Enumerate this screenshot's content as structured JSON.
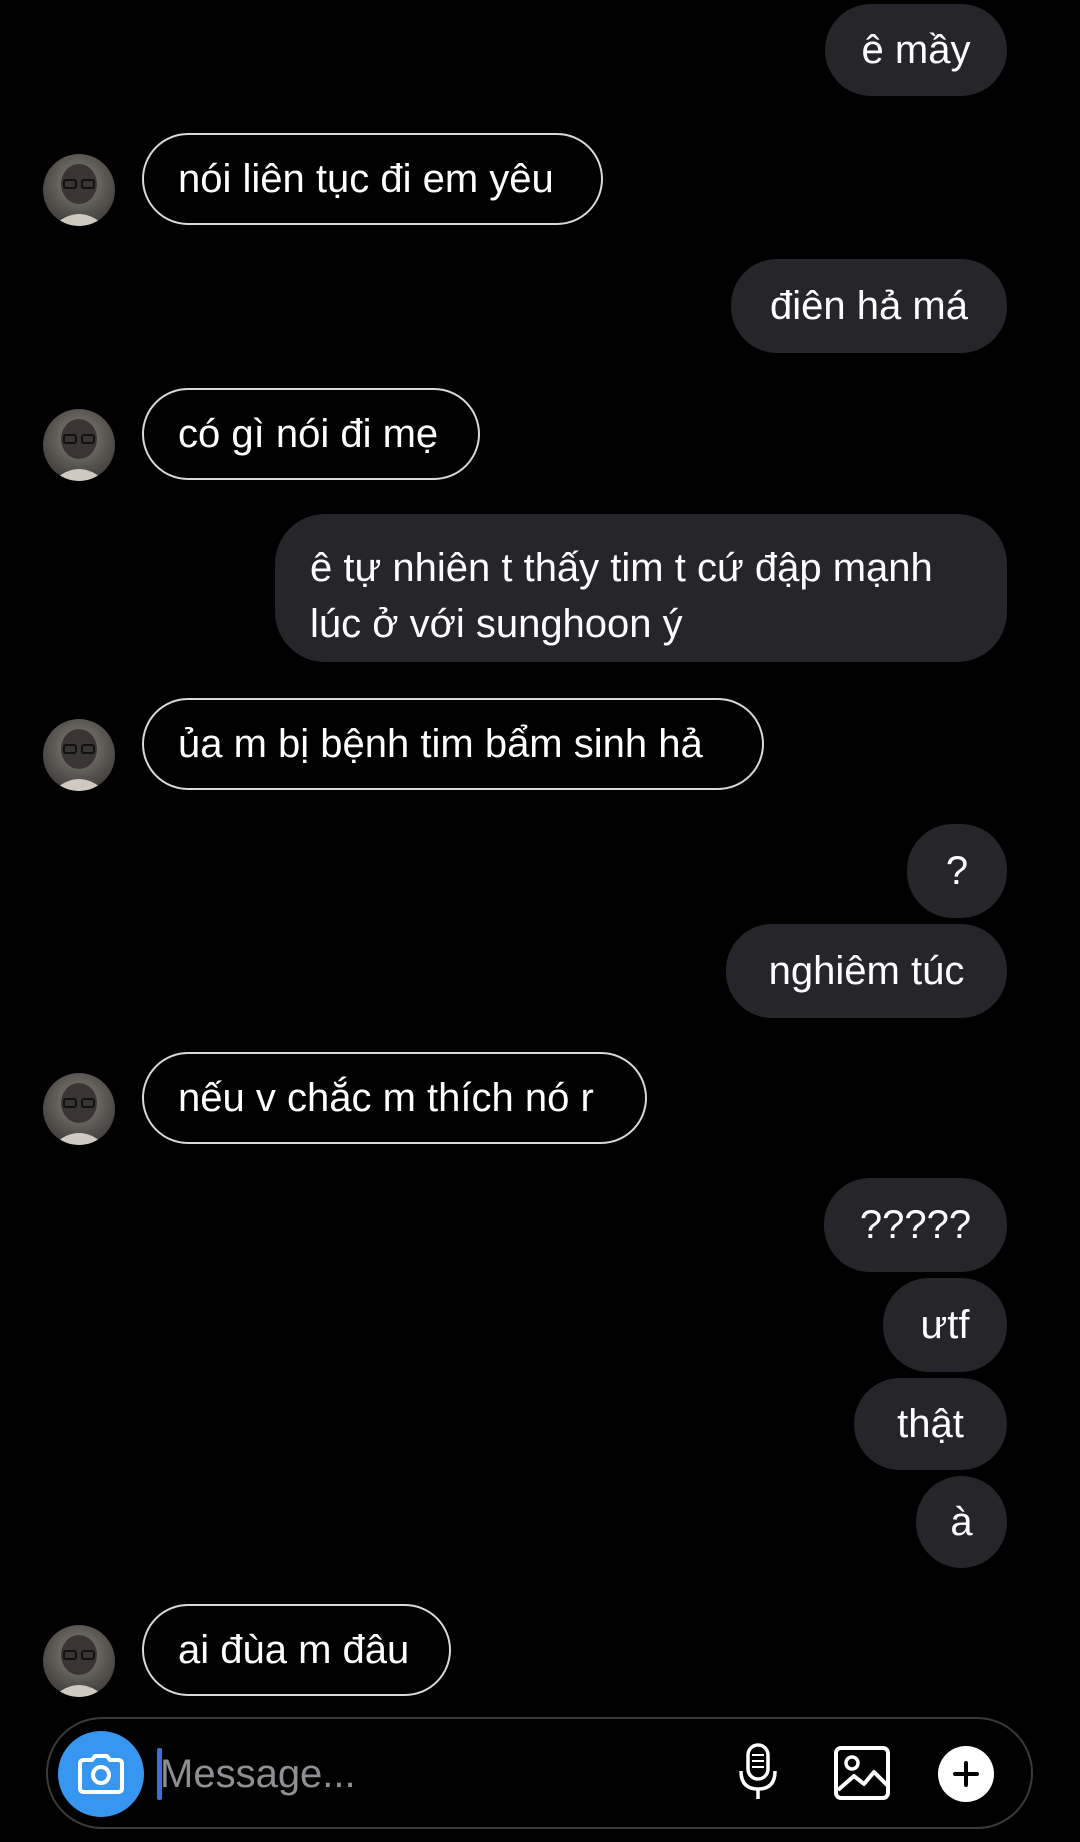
{
  "thread": {
    "messages": [
      {
        "side": "sent",
        "text": "ê mầy"
      },
      {
        "side": "received",
        "text": "nói liên tục đi em yêu"
      },
      {
        "side": "sent",
        "text": "điên hả má"
      },
      {
        "side": "received",
        "text": "có gì nói đi mẹ"
      },
      {
        "side": "sent",
        "line1": "ê tự nhiên t thấy tim t cứ đập mạnh",
        "line2": "lúc ở với sunghoon ý"
      },
      {
        "side": "received",
        "text": "ủa m bị bệnh tim bẩm sinh hả"
      },
      {
        "side": "sent",
        "text": "?"
      },
      {
        "side": "sent",
        "text": "nghiêm túc"
      },
      {
        "side": "received",
        "text": "nếu v chắc m thích nó r"
      },
      {
        "side": "sent",
        "text": "?????"
      },
      {
        "side": "sent",
        "text": "ưtf"
      },
      {
        "side": "sent",
        "text": "thật"
      },
      {
        "side": "sent",
        "text": "à"
      },
      {
        "side": "received",
        "text": "ai đùa m đâu"
      }
    ]
  },
  "composer": {
    "placeholder": "Message...",
    "value": ""
  },
  "icons": {
    "camera": "camera-icon",
    "mic": "microphone-icon",
    "gallery": "gallery-icon",
    "add": "plus-icon",
    "avatar": "contact-avatar"
  },
  "colors": {
    "background": "#000000",
    "sent_bubble": "#26252a",
    "received_border": "#d9d9d9",
    "camera_button": "#3797f0",
    "caret": "#3a6fe0",
    "placeholder": "#8e8e93"
  }
}
